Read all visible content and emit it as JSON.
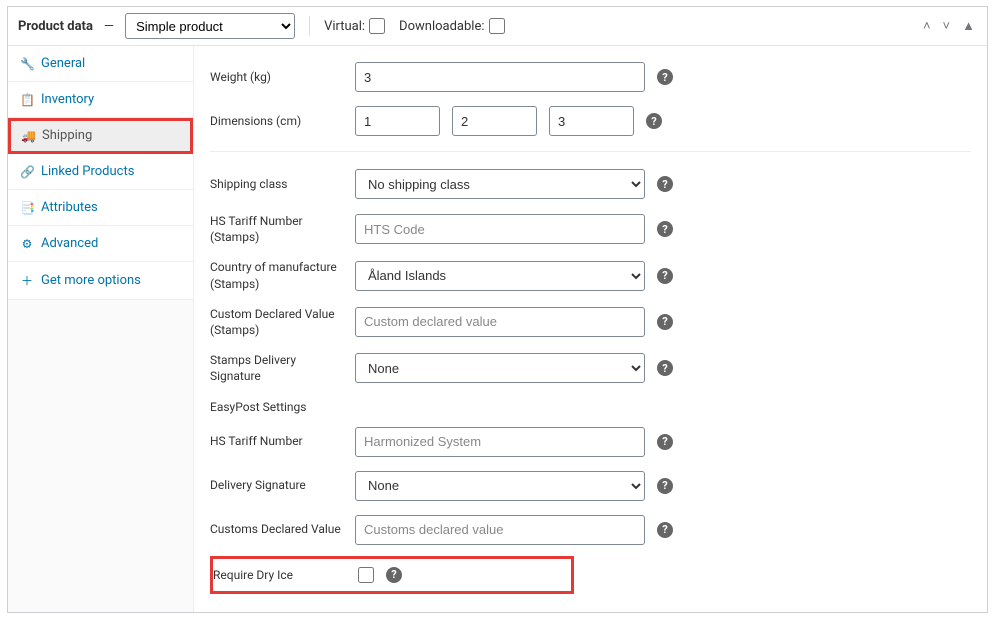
{
  "header": {
    "title": "Product data",
    "type_select": "Simple product",
    "virtual_label": "Virtual:",
    "downloadable_label": "Downloadable:"
  },
  "sidebar": {
    "items": [
      {
        "label": "General",
        "icon": "🔧"
      },
      {
        "label": "Inventory",
        "icon": "📋"
      },
      {
        "label": "Shipping",
        "icon": "🚚"
      },
      {
        "label": "Linked Products",
        "icon": "🔗"
      },
      {
        "label": "Attributes",
        "icon": "📑"
      },
      {
        "label": "Advanced",
        "icon": "⚙"
      },
      {
        "label": "Get more options",
        "icon": "＋"
      }
    ]
  },
  "fields": {
    "weight_label": "Weight (kg)",
    "weight_value": "3",
    "dimensions_label": "Dimensions (cm)",
    "dim_l": "1",
    "dim_w": "2",
    "dim_h": "3",
    "shipping_class_label": "Shipping class",
    "shipping_class_value": "No shipping class",
    "hs_tariff_stamps_label": "HS Tariff Number (Stamps)",
    "hs_tariff_stamps_placeholder": "HTS Code",
    "country_label": "Country of manufacture (Stamps)",
    "country_value": "Åland Islands",
    "custom_declared_stamps_label": "Custom Declared Value (Stamps)",
    "custom_declared_stamps_placeholder": "Custom declared value",
    "stamps_signature_label": "Stamps Delivery Signature",
    "stamps_signature_value": "None",
    "easypost_heading": "EasyPost Settings",
    "hs_tariff_label": "HS Tariff Number",
    "hs_tariff_placeholder": "Harmonized System",
    "delivery_signature_label": "Delivery Signature",
    "delivery_signature_value": "None",
    "customs_declared_label": "Customs Declared Value",
    "customs_declared_placeholder": "Customs declared value",
    "dry_ice_label": "Require Dry Ice"
  }
}
